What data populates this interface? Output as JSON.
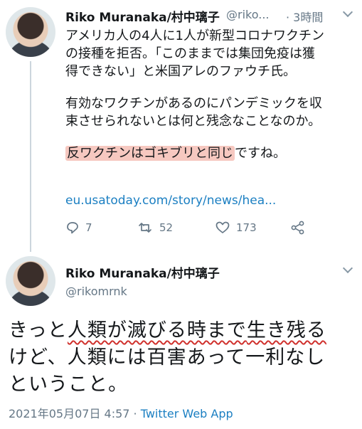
{
  "tweet1": {
    "author_name": "Riko Muranaka/村中璃子",
    "author_handle": "@riko...",
    "time": "· 3時間",
    "line1": "アメリカ人の4人に1人が新型コロナワクチン",
    "line2": "の接種を拒否。「このままでは集団免疫は獲",
    "line3": "得できない」と米国アレのファウチ氏。",
    "line4": "有効なワクチンがあるのにパンデミックを収",
    "line5": "束させられないとは何と残念なことなのか。",
    "highlight": "反ワクチンはゴキブリと同じ",
    "highlight_tail": "ですね。",
    "link": "eu.usatoday.com/story/news/hea...",
    "reply_count": "7",
    "retweet_count": "52",
    "like_count": "173"
  },
  "tweet2": {
    "author_name": "Riko Muranaka/村中璃子",
    "author_handle": "@rikomrnk",
    "text_pre": "きっと",
    "text_underlined_1": "人類が滅びる時まで",
    "text_underlined_2": "生き残る",
    "text_line2": "けど、人類には百害あって一利なし",
    "text_line3": "ということ。",
    "timestamp": "2021年05月07日 4:57 · ",
    "source": "Twitter Web App"
  },
  "colors": {
    "highlight_bg": "#f6c8c0",
    "underline": "#d0312d",
    "link": "#1b7fc2",
    "muted": "#657786"
  }
}
